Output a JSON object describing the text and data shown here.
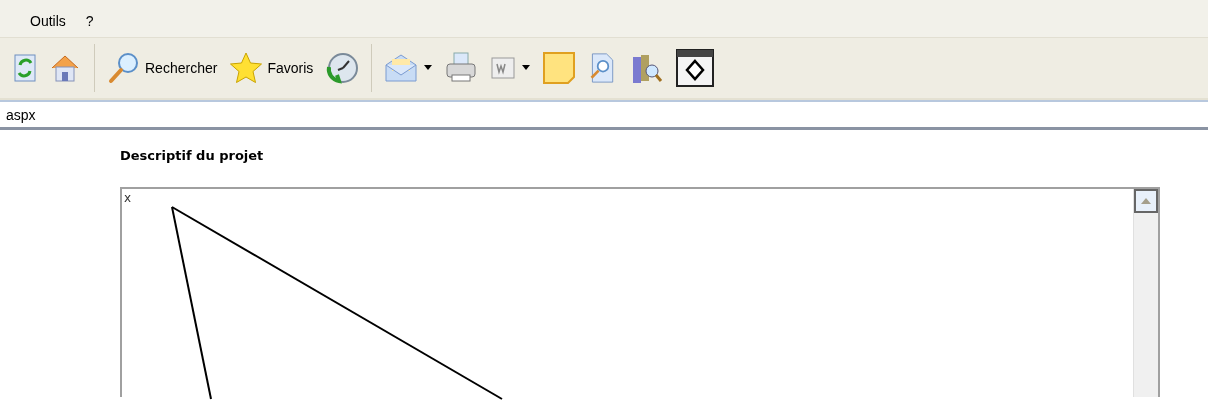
{
  "menu_bar": {
    "items": [
      "Outils",
      "?"
    ]
  },
  "toolbar": {
    "items": [
      {
        "kind": "refresh"
      },
      {
        "kind": "home"
      },
      {
        "kind": "separator"
      },
      {
        "kind": "search",
        "label": "Rechercher"
      },
      {
        "kind": "star",
        "label": "Favoris"
      },
      {
        "kind": "history"
      },
      {
        "kind": "separator"
      },
      {
        "kind": "mail"
      },
      {
        "kind": "caret"
      },
      {
        "kind": "printer"
      },
      {
        "kind": "word"
      },
      {
        "kind": "caret"
      },
      {
        "kind": "note"
      },
      {
        "kind": "docsearch"
      },
      {
        "kind": "books"
      },
      {
        "kind": "frame"
      }
    ]
  },
  "address_bar": {
    "value": "aspx"
  },
  "page": {
    "heading": "Descriptif du projet",
    "textarea": {
      "value": "x"
    }
  }
}
